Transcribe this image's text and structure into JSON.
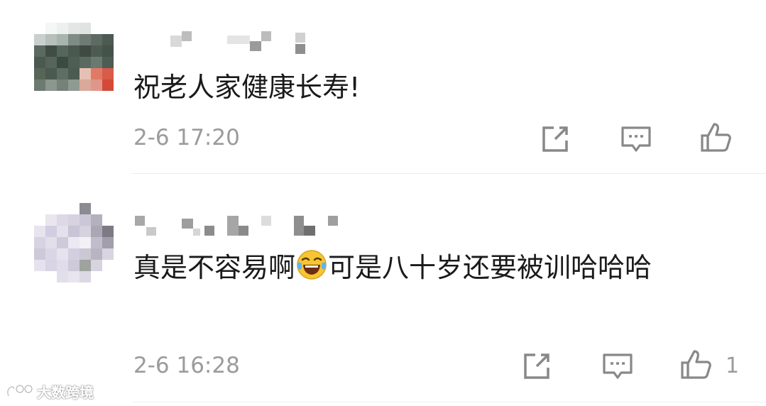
{
  "comments": [
    {
      "text": "祝老人家健康长寿!",
      "time": "2-6 17:20",
      "likes": ""
    },
    {
      "text_before_emoji": "真是不容易啊",
      "text_after_emoji": "可是八十岁还要被训哈哈哈",
      "time": "2-6 16:28",
      "likes": "1"
    }
  ],
  "icons": [
    "edit-icon",
    "reply-icon",
    "thumbs-up-icon",
    "laughing-tears-emoji"
  ],
  "watermark": {
    "text": "大数跨境"
  },
  "colors": {
    "text": "#1a1a1a",
    "meta": "#9b9b9b",
    "divider": "#ececec"
  }
}
